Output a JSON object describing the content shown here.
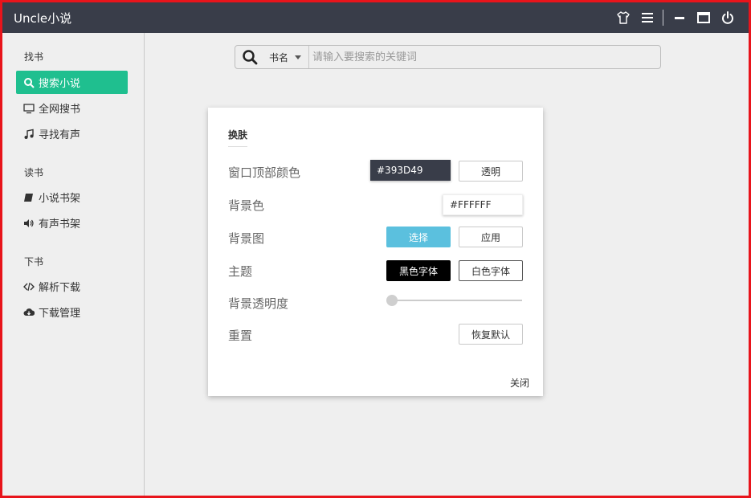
{
  "app": {
    "title": "Uncle小说"
  },
  "titlebar": {
    "icons": [
      "shirt-icon",
      "menu-icon",
      "minimize-icon",
      "maximize-icon",
      "power-icon"
    ]
  },
  "sidebar": {
    "sections": [
      {
        "label": "找书",
        "items": [
          {
            "label": "搜索小说",
            "icon": "search-icon",
            "active": true
          },
          {
            "label": "全网搜书",
            "icon": "monitor-icon"
          },
          {
            "label": "寻找有声",
            "icon": "music-icon"
          }
        ]
      },
      {
        "label": "读书",
        "items": [
          {
            "label": "小说书架",
            "icon": "book-icon"
          },
          {
            "label": "有声书架",
            "icon": "speaker-icon"
          }
        ]
      },
      {
        "label": "下书",
        "items": [
          {
            "label": "解析下载",
            "icon": "code-icon"
          },
          {
            "label": "下载管理",
            "icon": "cloud-download-icon"
          }
        ]
      }
    ]
  },
  "search": {
    "type_label": "书名",
    "placeholder": "请输入要搜索的关键词",
    "value": ""
  },
  "dialog": {
    "title": "换肤",
    "rows": {
      "top_color_label": "窗口顶部颜色",
      "top_color_value": "#393D49",
      "transparent_button": "透明",
      "bg_color_label": "背景色",
      "bg_color_value": "#FFFFFF",
      "bg_image_label": "背景图",
      "select_button": "选择",
      "apply_button": "应用",
      "theme_label": "主题",
      "dark_font_button": "黑色字体",
      "light_font_button": "白色字体",
      "opacity_label": "背景透明度",
      "opacity_value": 0,
      "reset_label": "重置",
      "restore_button": "恢复默认"
    },
    "close_label": "关闭"
  },
  "colors": {
    "titlebar": "#393d49",
    "accent": "#1fbf8f",
    "select_button": "#5bc0de",
    "frame_border": "#e8141b"
  }
}
